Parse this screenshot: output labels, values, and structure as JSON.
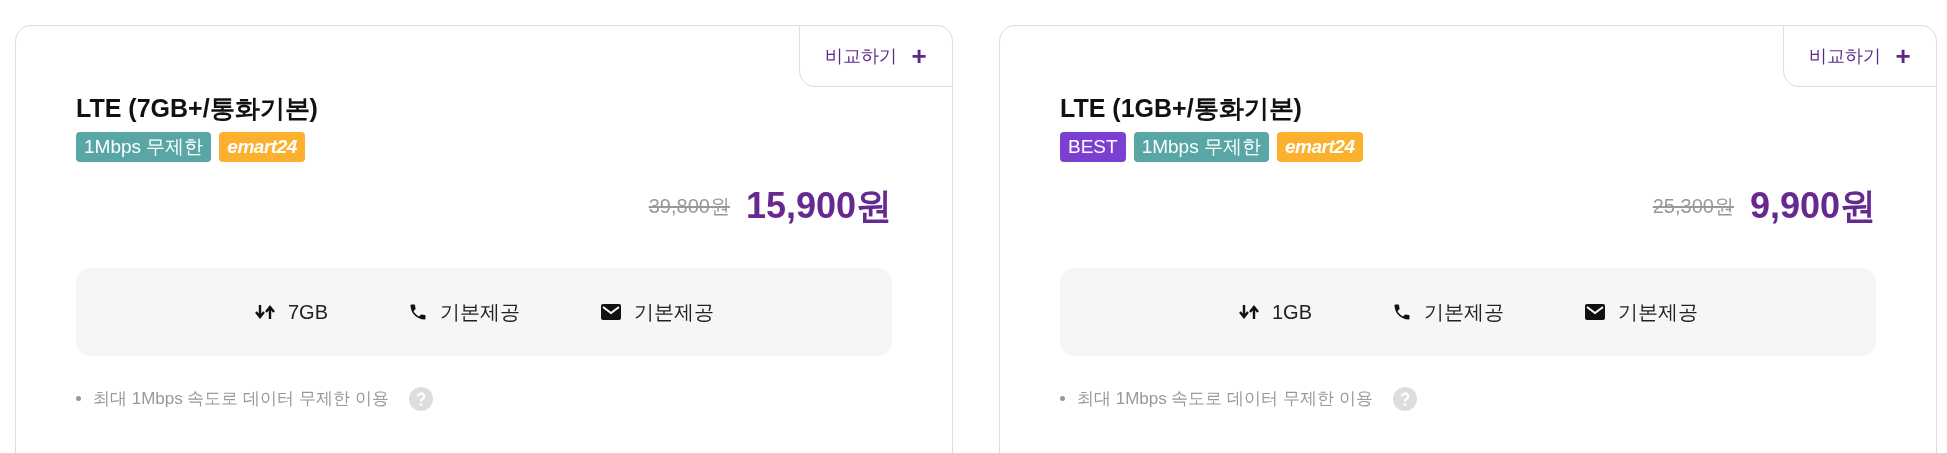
{
  "plans": [
    {
      "title": "LTE (7GB+/통화기본)",
      "compare_button": {
        "label": "비교하기",
        "icon": "+"
      },
      "badges": [
        {
          "kind": "tag",
          "label": "1Mbps 무제한"
        },
        {
          "kind": "logo",
          "label": "emart24"
        }
      ],
      "original_price": "39,800원",
      "price": "15,900원",
      "features": [
        {
          "kind": "data",
          "label": "7GB"
        },
        {
          "kind": "call",
          "label": "기본제공"
        },
        {
          "kind": "sms",
          "label": "기본제공"
        }
      ],
      "note": "최대 1Mbps 속도로 데이터 무제한 이용"
    },
    {
      "title": "LTE (1GB+/통화기본)",
      "compare_button": {
        "label": "비교하기",
        "icon": "+"
      },
      "badges": [
        {
          "kind": "best",
          "label": "BEST"
        },
        {
          "kind": "tag",
          "label": "1Mbps 무제한"
        },
        {
          "kind": "logo",
          "label": "emart24"
        }
      ],
      "original_price": "25,300원",
      "price": "9,900원",
      "features": [
        {
          "kind": "data",
          "label": "1GB"
        },
        {
          "kind": "call",
          "label": "기본제공"
        },
        {
          "kind": "sms",
          "label": "기본제공"
        }
      ],
      "note": "최대 1Mbps 속도로 데이터 무제한 이용"
    }
  ]
}
